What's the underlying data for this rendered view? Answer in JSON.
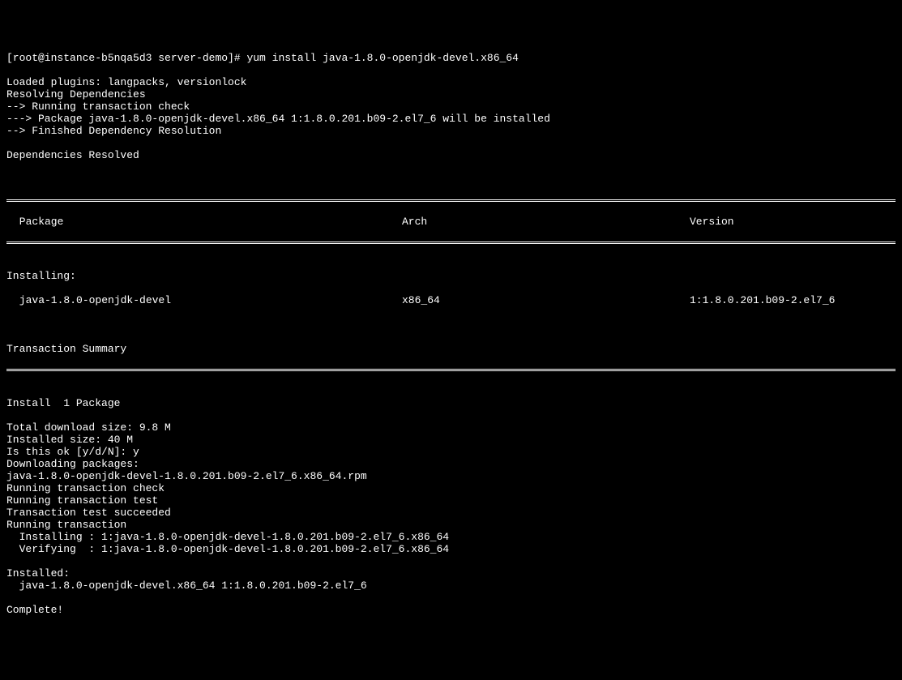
{
  "prompt": "[root@instance-b5nqa5d3 server-demo]# yum install java-1.8.0-openjdk-devel.x86_64",
  "pre": [
    "Loaded plugins: langpacks, versionlock",
    "Resolving Dependencies",
    "--> Running transaction check",
    "---> Package java-1.8.0-openjdk-devel.x86_64 1:1.8.0.201.b09-2.el7_6 will be installed",
    "--> Finished Dependency Resolution",
    "",
    "Dependencies Resolved",
    ""
  ],
  "headers": {
    "package": " Package",
    "arch": "Arch",
    "version": "Version"
  },
  "installing_label": "Installing:",
  "row": {
    "package": " java-1.8.0-openjdk-devel",
    "arch": "x86_64",
    "version": "1:1.8.0.201.b09-2.el7_6"
  },
  "txn_summary": "Transaction Summary",
  "post": [
    "Install  1 Package",
    "",
    "Total download size: 9.8 M",
    "Installed size: 40 M",
    "Is this ok [y/d/N]: y",
    "Downloading packages:",
    "java-1.8.0-openjdk-devel-1.8.0.201.b09-2.el7_6.x86_64.rpm",
    "Running transaction check",
    "Running transaction test",
    "Transaction test succeeded",
    "Running transaction",
    "  Installing : 1:java-1.8.0-openjdk-devel-1.8.0.201.b09-2.el7_6.x86_64",
    "  Verifying  : 1:java-1.8.0-openjdk-devel-1.8.0.201.b09-2.el7_6.x86_64",
    "",
    "Installed:",
    "  java-1.8.0-openjdk-devel.x86_64 1:1.8.0.201.b09-2.el7_6",
    "",
    "Complete!"
  ]
}
